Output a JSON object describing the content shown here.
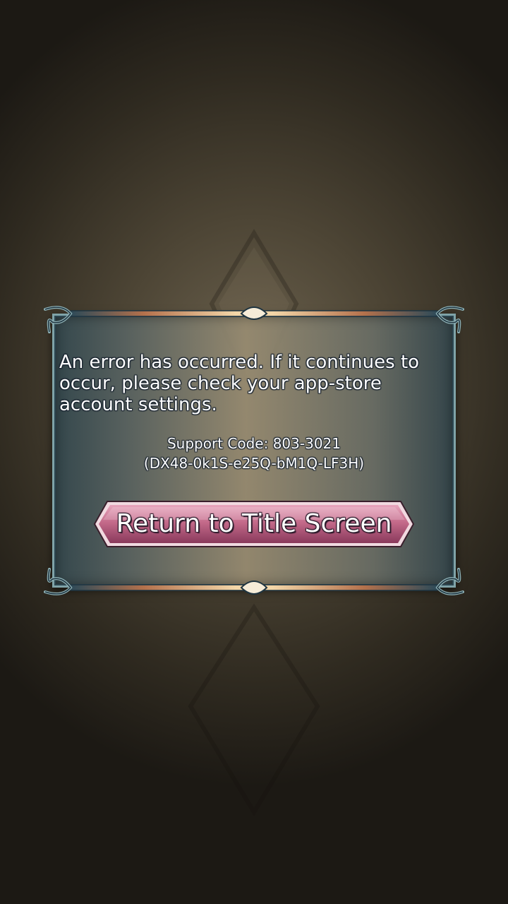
{
  "dialog": {
    "message": "An error has occurred. If it continues to occur, please check your app-store account settings.",
    "support_code": "Support Code: 803-3021",
    "support_detail": "(DX48-0k1S-e25Q-bM1Q-LF3H)",
    "return_button_label": "Return to Title Screen"
  },
  "icons": {
    "frame_ornament": "celtic-knot-corner-icon",
    "background_emblem": "diamond-emblem-icon"
  },
  "colors": {
    "frame_teal": "#7fa3a8",
    "frame_copper": "#d08a5a",
    "button_pink": "#c9708e",
    "background_dark": "#2f2a20"
  }
}
